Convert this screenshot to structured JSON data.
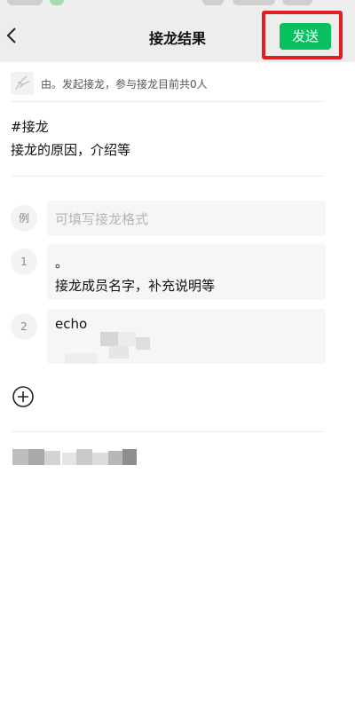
{
  "nav": {
    "title": "接龙结果",
    "send_label": "发送",
    "back_icon": "chevron-left-icon"
  },
  "initiator": {
    "text": "由。发起接龙，参与接龙目前共0人"
  },
  "topic": {
    "title": "#接龙",
    "description": "接龙的原因，介绍等"
  },
  "format_row": {
    "badge": "例",
    "placeholder": "可填写接龙格式"
  },
  "entries": [
    {
      "number": "1",
      "line1": "。",
      "line2": "接龙成员名字，补充说明等"
    },
    {
      "number": "2",
      "line1": "echo",
      "line2": ""
    }
  ],
  "add_icon": "plus-circle-icon",
  "colors": {
    "accent": "#07c160",
    "highlight": "#e02020",
    "nav_background": "#ededed"
  }
}
